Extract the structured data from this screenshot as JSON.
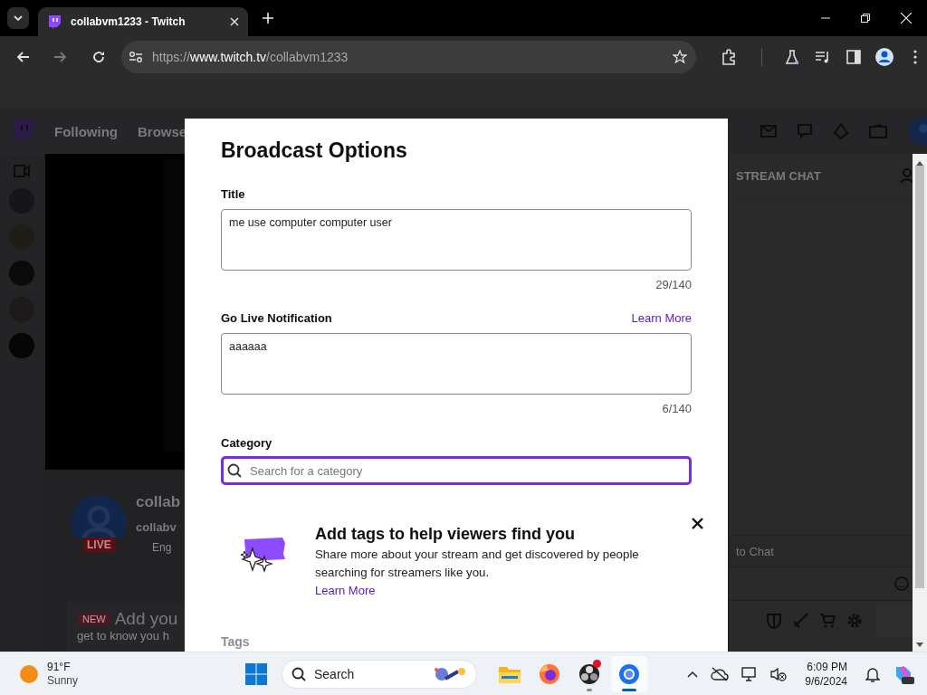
{
  "browser": {
    "tab_title": "collabvm1233 - Twitch",
    "url": "https://**www.twitch.tv**/collabvm1233"
  },
  "page": {
    "nav": [
      "Following",
      "Browse"
    ],
    "chat_header": "STREAM CHAT",
    "channel_title": "collab",
    "channel_name": "collabv",
    "channel_tag": "Eng",
    "live_badge": "LIVE",
    "new_badge": "NEW",
    "promo_title": "Add you",
    "promo_text": "get to know you h",
    "chat_field": "to Chat"
  },
  "modal": {
    "title": "Broadcast Options",
    "fields": [
      {
        "label": "Title",
        "value": "me use computer computer user",
        "counter": "29/140"
      },
      {
        "label": "Go Live Notification",
        "link": "Learn More",
        "value": "aaaaaa",
        "counter": "6/140"
      }
    ],
    "category": {
      "label": "Category",
      "placeholder": "Search for a category",
      "focused": true
    },
    "tags_banner": {
      "title": "Add tags to help viewers find you",
      "text": "Share more about your stream and get discovered by people searching for streamers like you.",
      "link": "Learn More"
    },
    "tags_label": "Tags"
  },
  "taskbar": {
    "temperature": "91°F",
    "condition": "Sunny",
    "search": "Search",
    "apps": [
      {
        "kind": "files",
        "running": false,
        "active": false,
        "alert": false
      },
      {
        "kind": "firefox",
        "running": false,
        "active": false,
        "alert": false
      },
      {
        "kind": "recorder",
        "running": true,
        "active": false,
        "alert": true
      },
      {
        "kind": "chrome",
        "running": true,
        "active": true,
        "alert": false
      }
    ],
    "time": "6:09 PM",
    "date": "9/6/2024"
  }
}
